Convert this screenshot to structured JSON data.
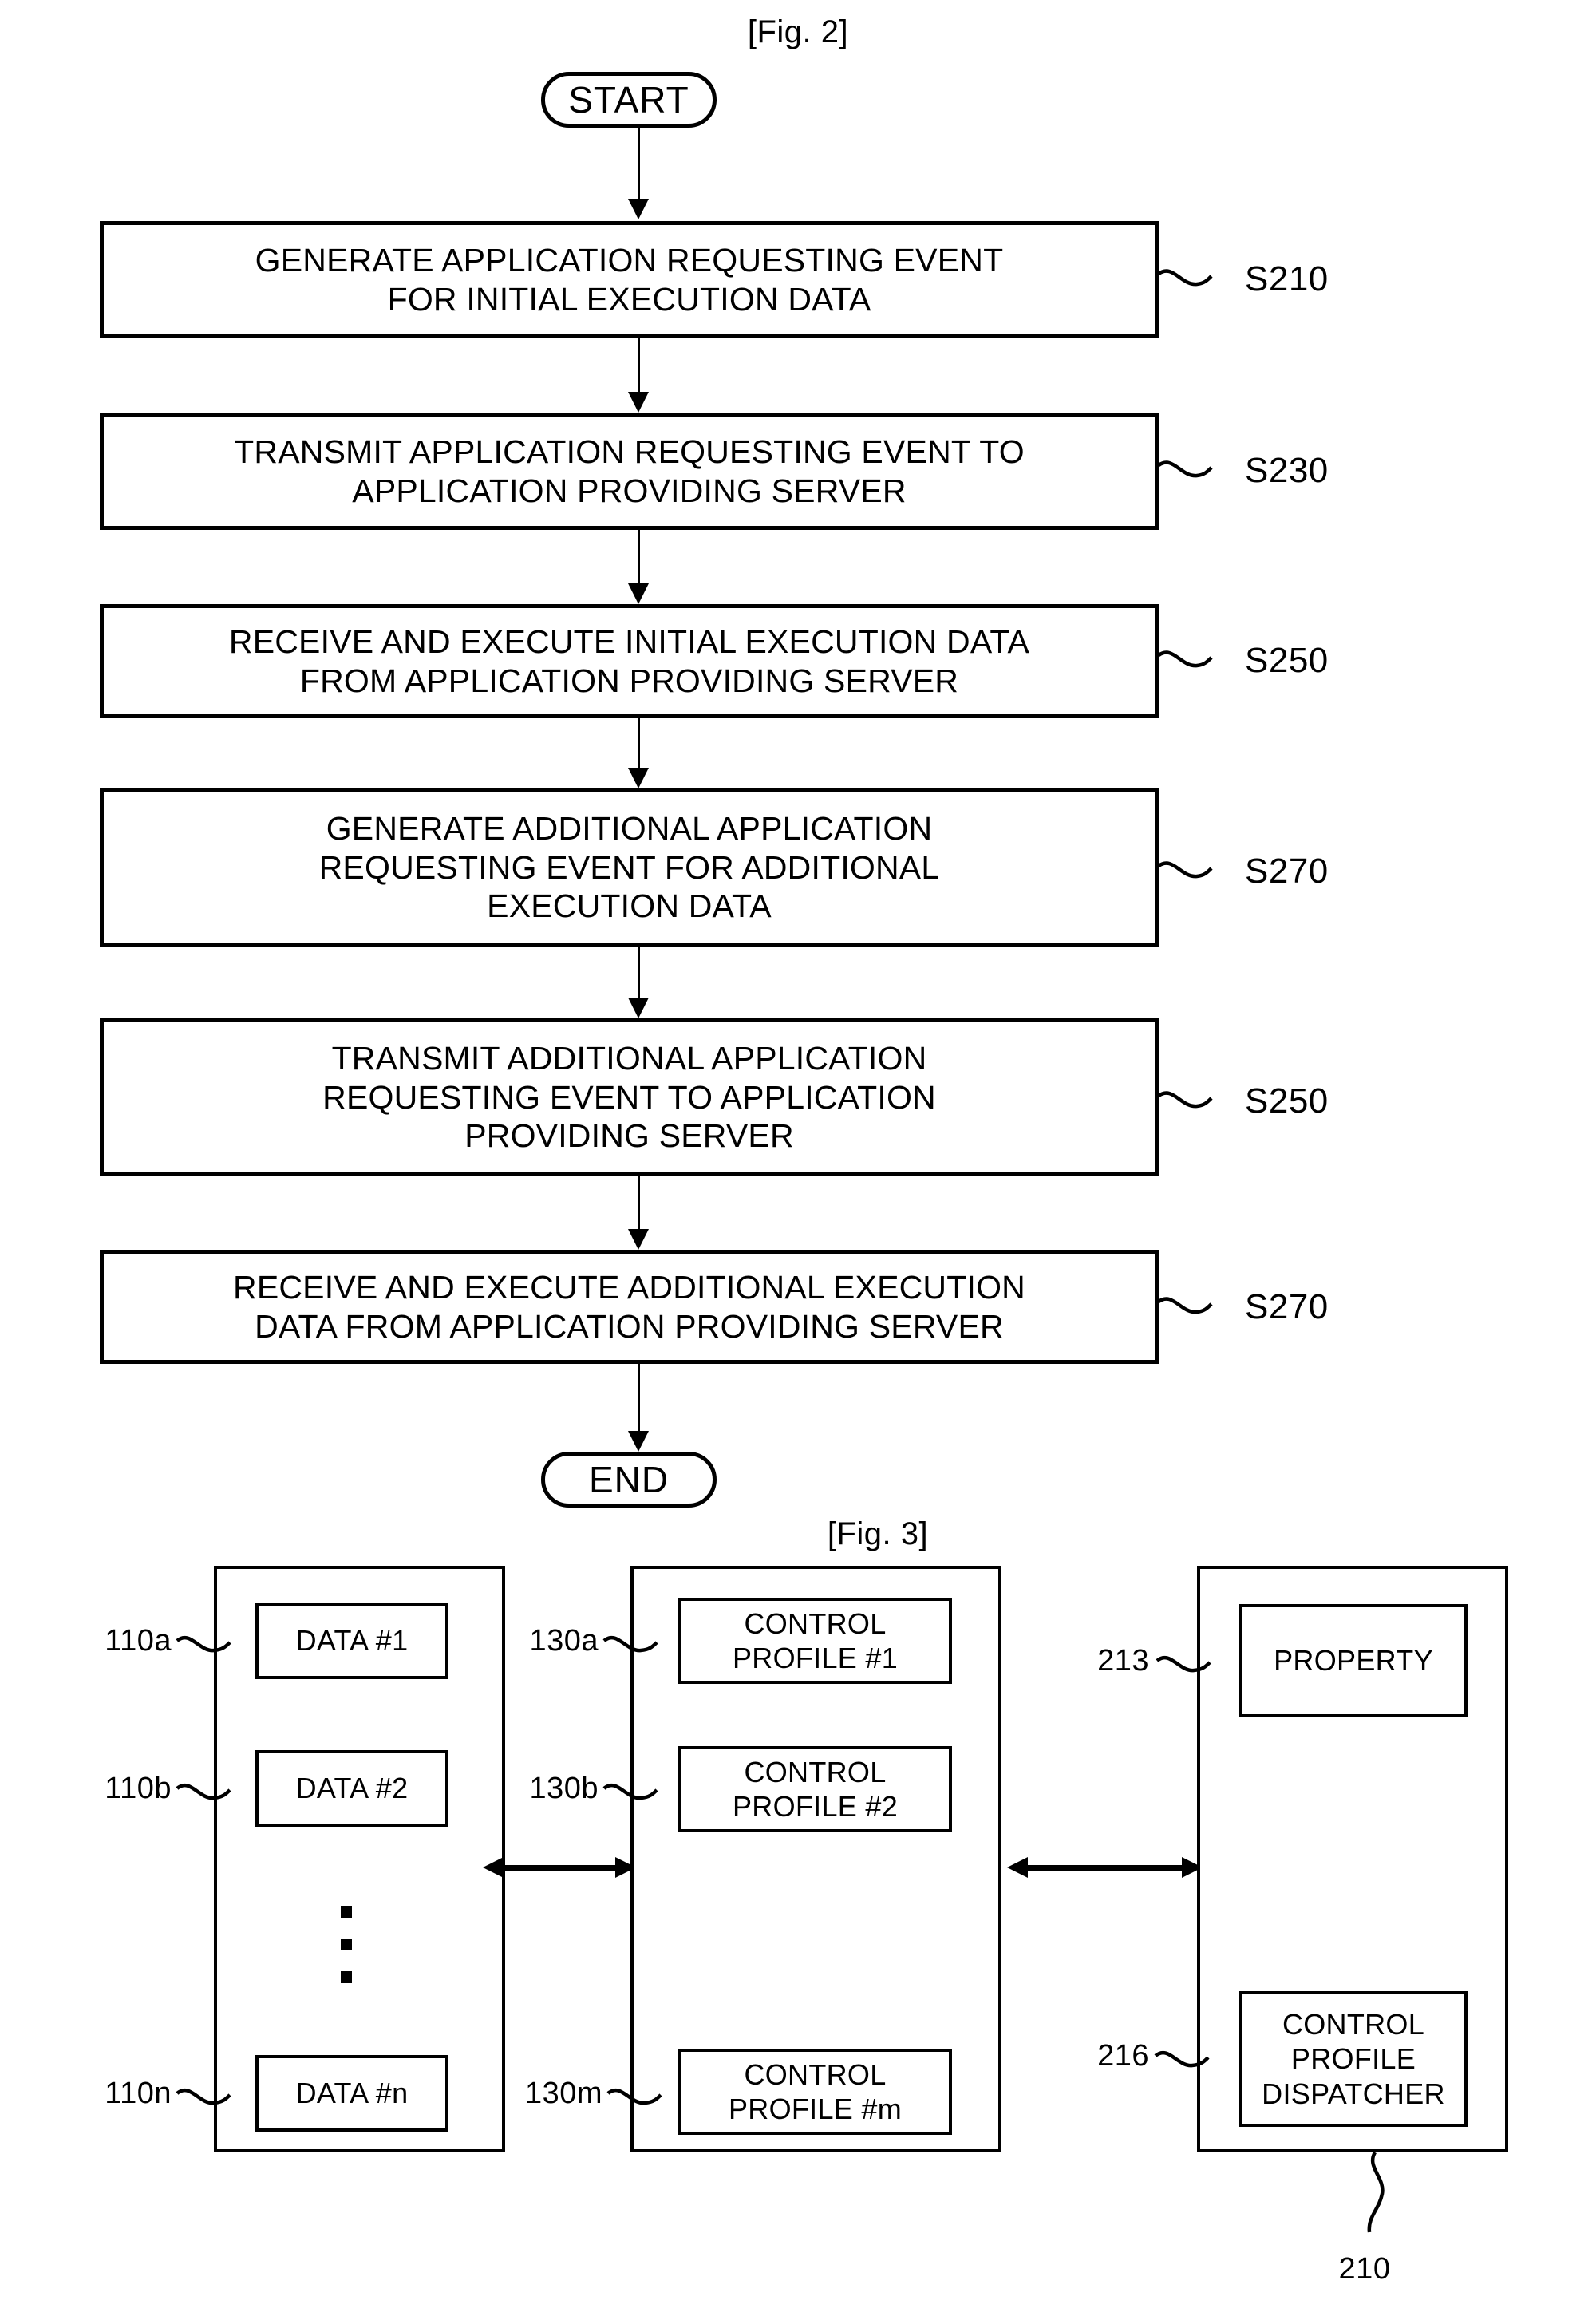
{
  "figures": [
    {
      "caption": "[Fig. 2]",
      "type": "flowchart",
      "start_label": "START",
      "end_label": "END",
      "steps": [
        {
          "text": "GENERATE APPLICATION REQUESTING EVENT\nFOR INITIAL EXECUTION DATA",
          "ref": "S210"
        },
        {
          "text": "TRANSMIT APPLICATION REQUESTING EVENT TO\nAPPLICATION PROVIDING SERVER",
          "ref": "S230"
        },
        {
          "text": "RECEIVE AND EXECUTE INITIAL EXECUTION DATA\nFROM APPLICATION PROVIDING SERVER",
          "ref": "S250"
        },
        {
          "text": "GENERATE ADDITIONAL APPLICATION\nREQUESTING EVENT FOR ADDITIONAL\nEXECUTION DATA",
          "ref": "S270"
        },
        {
          "text": "TRANSMIT ADDITIONAL APPLICATION\nREQUESTING EVENT TO APPLICATION\nPROVIDING SERVER",
          "ref": "S250"
        },
        {
          "text": "RECEIVE AND EXECUTE ADDITIONAL EXECUTION\nDATA FROM APPLICATION PROVIDING SERVER",
          "ref": "S270"
        }
      ]
    },
    {
      "caption": "[Fig. 3]",
      "type": "block-diagram",
      "columns": [
        {
          "name": "data-column",
          "items": [
            {
              "ref": "110a",
              "text": "DATA #1"
            },
            {
              "ref": "110b",
              "text": "DATA #2"
            },
            {
              "ref": "110n",
              "text": "DATA #n"
            }
          ],
          "ellipsis": true
        },
        {
          "name": "control-profile-column",
          "items": [
            {
              "ref": "130a",
              "text": "CONTROL\nPROFILE #1"
            },
            {
              "ref": "130b",
              "text": "CONTROL\nPROFILE #2"
            },
            {
              "ref": "130m",
              "text": "CONTROL\nPROFILE #m"
            }
          ],
          "ellipsis": true
        },
        {
          "name": "dispatcher-column",
          "items": [
            {
              "ref": "213",
              "text": "PROPERTY"
            },
            {
              "ref": "216",
              "text": "CONTROL\nPROFILE\nDISPATCHER"
            }
          ],
          "ellipsis": false,
          "column_ref": "210"
        }
      ],
      "connectors": [
        {
          "name": "data-to-profile",
          "style": "bidirectional"
        },
        {
          "name": "profile-to-dispatcher",
          "style": "bidirectional"
        }
      ]
    }
  ],
  "colors": {
    "stroke": "#000000",
    "background": "#ffffff"
  }
}
